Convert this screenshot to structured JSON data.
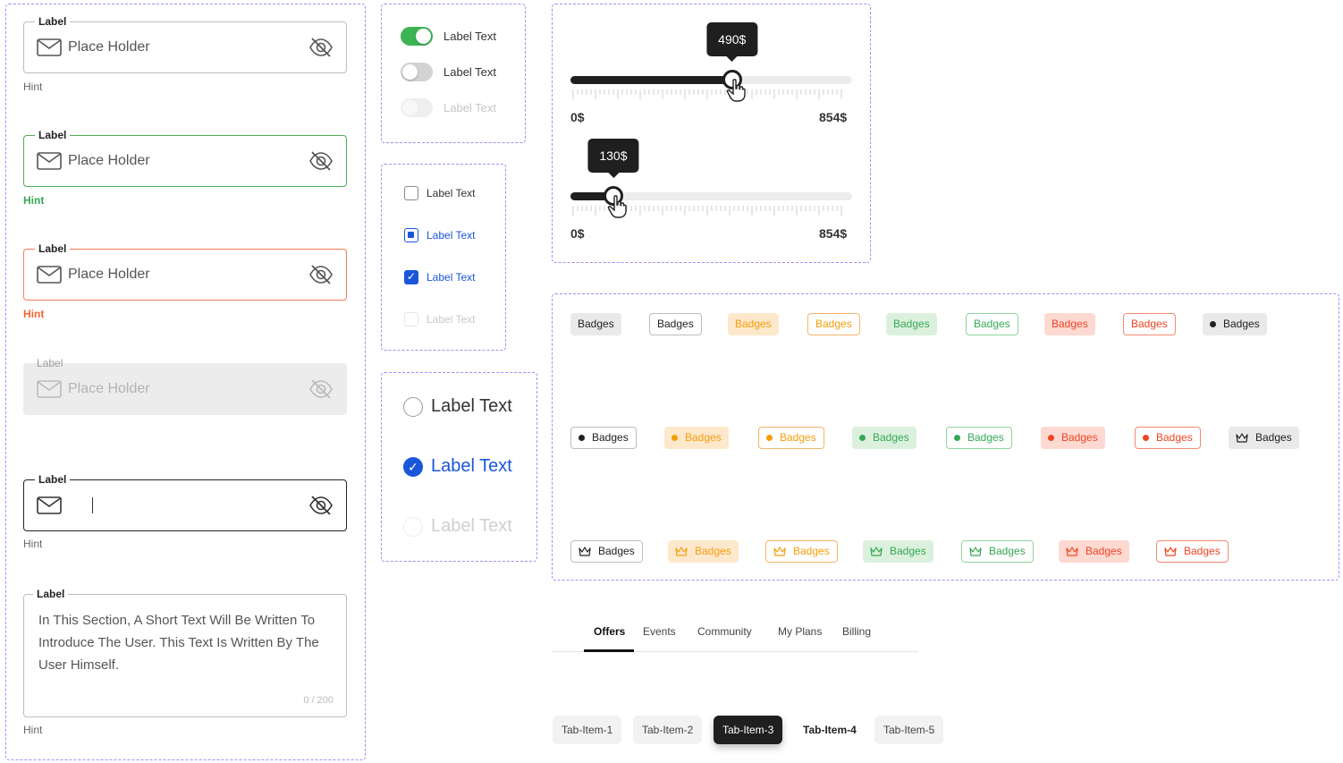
{
  "inputs": {
    "default": {
      "label": "Label",
      "placeholder": "Place Holder",
      "hint": "Hint"
    },
    "success": {
      "label": "Label",
      "placeholder": "Place Holder",
      "hint": "Hint"
    },
    "error": {
      "label": "Label",
      "placeholder": "Place Holder",
      "hint": "Hint"
    },
    "disabled": {
      "label": "Label",
      "placeholder": "Place Holder"
    },
    "focused": {
      "label": "Label",
      "hint": "Hint"
    },
    "textarea": {
      "label": "Label",
      "text": "In This Section, A Short Text Will Be Written To Introduce The User. This Text Is Written By The User Himself.",
      "counter": "0 / 200",
      "hint": "Hint"
    }
  },
  "toggles": [
    {
      "label": "Label Text",
      "state": "on"
    },
    {
      "label": "Label Text",
      "state": "off"
    },
    {
      "label": "Label Text",
      "state": "disabled"
    }
  ],
  "checkboxes": [
    {
      "label": "Label Text",
      "state": "unchecked"
    },
    {
      "label": "Label Text",
      "state": "indeterminate"
    },
    {
      "label": "Label Text",
      "state": "checked"
    },
    {
      "label": "Label Text",
      "state": "disabled"
    }
  ],
  "radios": [
    {
      "label": "Label Text",
      "state": "unselected"
    },
    {
      "label": "Label Text",
      "state": "selected"
    },
    {
      "label": "Label Text",
      "state": "disabled"
    }
  ],
  "sliders": [
    {
      "value_label": "490$",
      "value": 490,
      "min_label": "0$",
      "max_label": "854$",
      "min": 0,
      "max": 854
    },
    {
      "value_label": "130$",
      "value": 130,
      "min_label": "0$",
      "max_label": "854$",
      "min": 0,
      "max": 854
    }
  ],
  "badges": {
    "text": "Badges",
    "row1": [
      "grey-f",
      "grey-o",
      "orange-f",
      "orange-o",
      "green-f",
      "green-o",
      "red-f",
      "red-o",
      "grey-f dot"
    ],
    "row2": [
      "grey-o dot",
      "orange-f dot",
      "orange-o dot",
      "green-f dot",
      "green-o dot",
      "red-f dot",
      "red-o dot",
      "grey-f crown"
    ],
    "row3": [
      "grey-o crown",
      "orange-f crown",
      "orange-o crown",
      "green-f crown",
      "green-o crown",
      "red-f crown",
      "red-o crown"
    ]
  },
  "tabs": {
    "underline": [
      "Offers",
      "Events",
      "Community",
      "My Plans",
      "Billing"
    ],
    "active_underline": "Offers",
    "pills": [
      "Tab-Item-1",
      "Tab-Item-2",
      "Tab-Item-3",
      "Tab-Item-4",
      "Tab-Item-5"
    ],
    "active_pill": "Tab-Item-3"
  },
  "colors": {
    "accent_blue": "#1a56db",
    "success": "#34a853",
    "error": "#ef4423",
    "warning": "#f59e0b",
    "dark": "#1f1f1f",
    "frame": "#a78bfa"
  }
}
